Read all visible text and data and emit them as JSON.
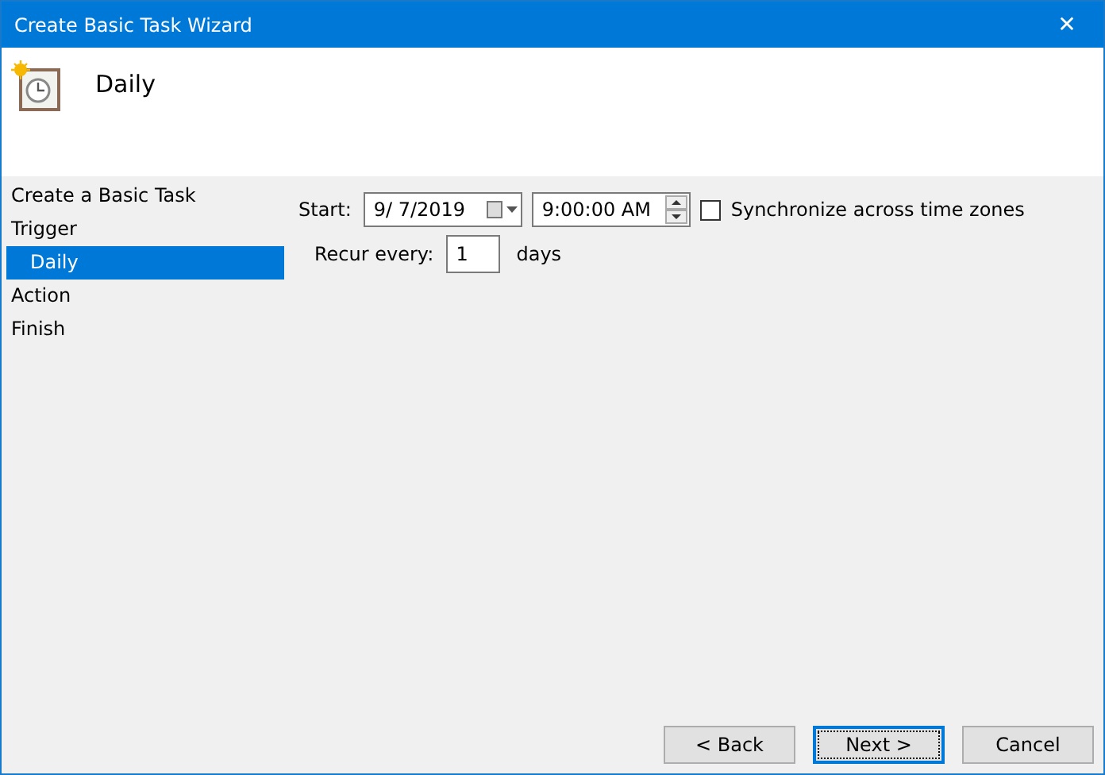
{
  "window": {
    "title": "Create Basic Task Wizard",
    "close": "✕"
  },
  "header": {
    "title": "Daily"
  },
  "steps": [
    {
      "label": "Create a Basic Task",
      "selected": false
    },
    {
      "label": "Trigger",
      "selected": false,
      "children": [
        {
          "label": "Daily",
          "selected": true
        }
      ]
    },
    {
      "label": "Action",
      "selected": false
    },
    {
      "label": "Finish",
      "selected": false
    }
  ],
  "start": {
    "label": "Start:",
    "date": "9/  7/2019",
    "time": "9:00:00 AM"
  },
  "sync": {
    "label": "Synchronize across time zones",
    "checked": false
  },
  "recur": {
    "label": "Recur every:",
    "value": "1",
    "unit": "days"
  },
  "buttons": [
    {
      "label": "< Back",
      "default": false
    },
    {
      "label": "Next >",
      "default": true
    },
    {
      "label": "Cancel",
      "default": false
    }
  ]
}
